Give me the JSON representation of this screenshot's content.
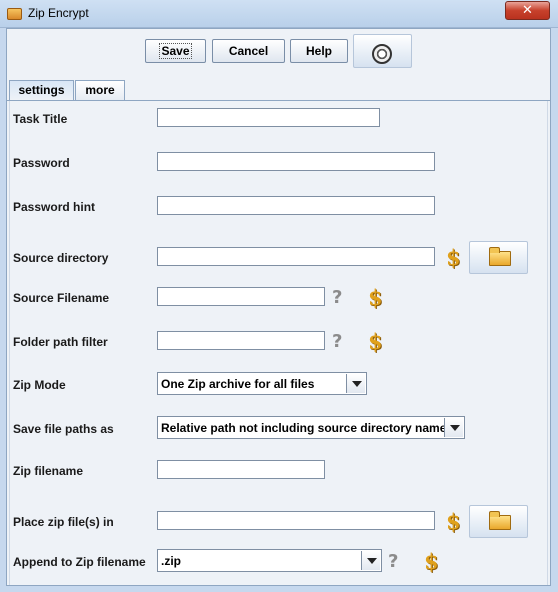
{
  "window": {
    "title": "Zip Encrypt",
    "close_glyph": "✕"
  },
  "toolbar": {
    "save_label": "Save",
    "cancel_label": "Cancel",
    "help_label": "Help",
    "options_icon": "gear-icon"
  },
  "tabs": [
    {
      "label": "settings",
      "active": true
    },
    {
      "label": "more",
      "active": false
    }
  ],
  "form": {
    "task_title": {
      "label": "Task Title",
      "value": ""
    },
    "password": {
      "label": "Password",
      "value": ""
    },
    "password_hint": {
      "label": "Password hint",
      "value": ""
    },
    "source_directory": {
      "label": "Source directory",
      "value": ""
    },
    "source_filename": {
      "label": "Source Filename",
      "value": ""
    },
    "folder_path_filter": {
      "label": "Folder path filter",
      "value": ""
    },
    "zip_mode": {
      "label": "Zip Mode",
      "value": "One Zip archive for all files"
    },
    "save_file_paths_as": {
      "label": "Save file paths as",
      "value": "Relative path not including source directory name"
    },
    "zip_filename": {
      "label": "Zip filename",
      "value": ""
    },
    "place_zip_files_in": {
      "label": "Place zip file(s) in",
      "value": ""
    },
    "append_to_zip_filename": {
      "label": "Append to Zip filename",
      "value": ".zip"
    }
  },
  "glyphs": {
    "help": "?",
    "variable": "$"
  },
  "colors": {
    "dollar": "#e0a11c",
    "help_mark": "#8b8b8b",
    "close": "#c7412c"
  }
}
